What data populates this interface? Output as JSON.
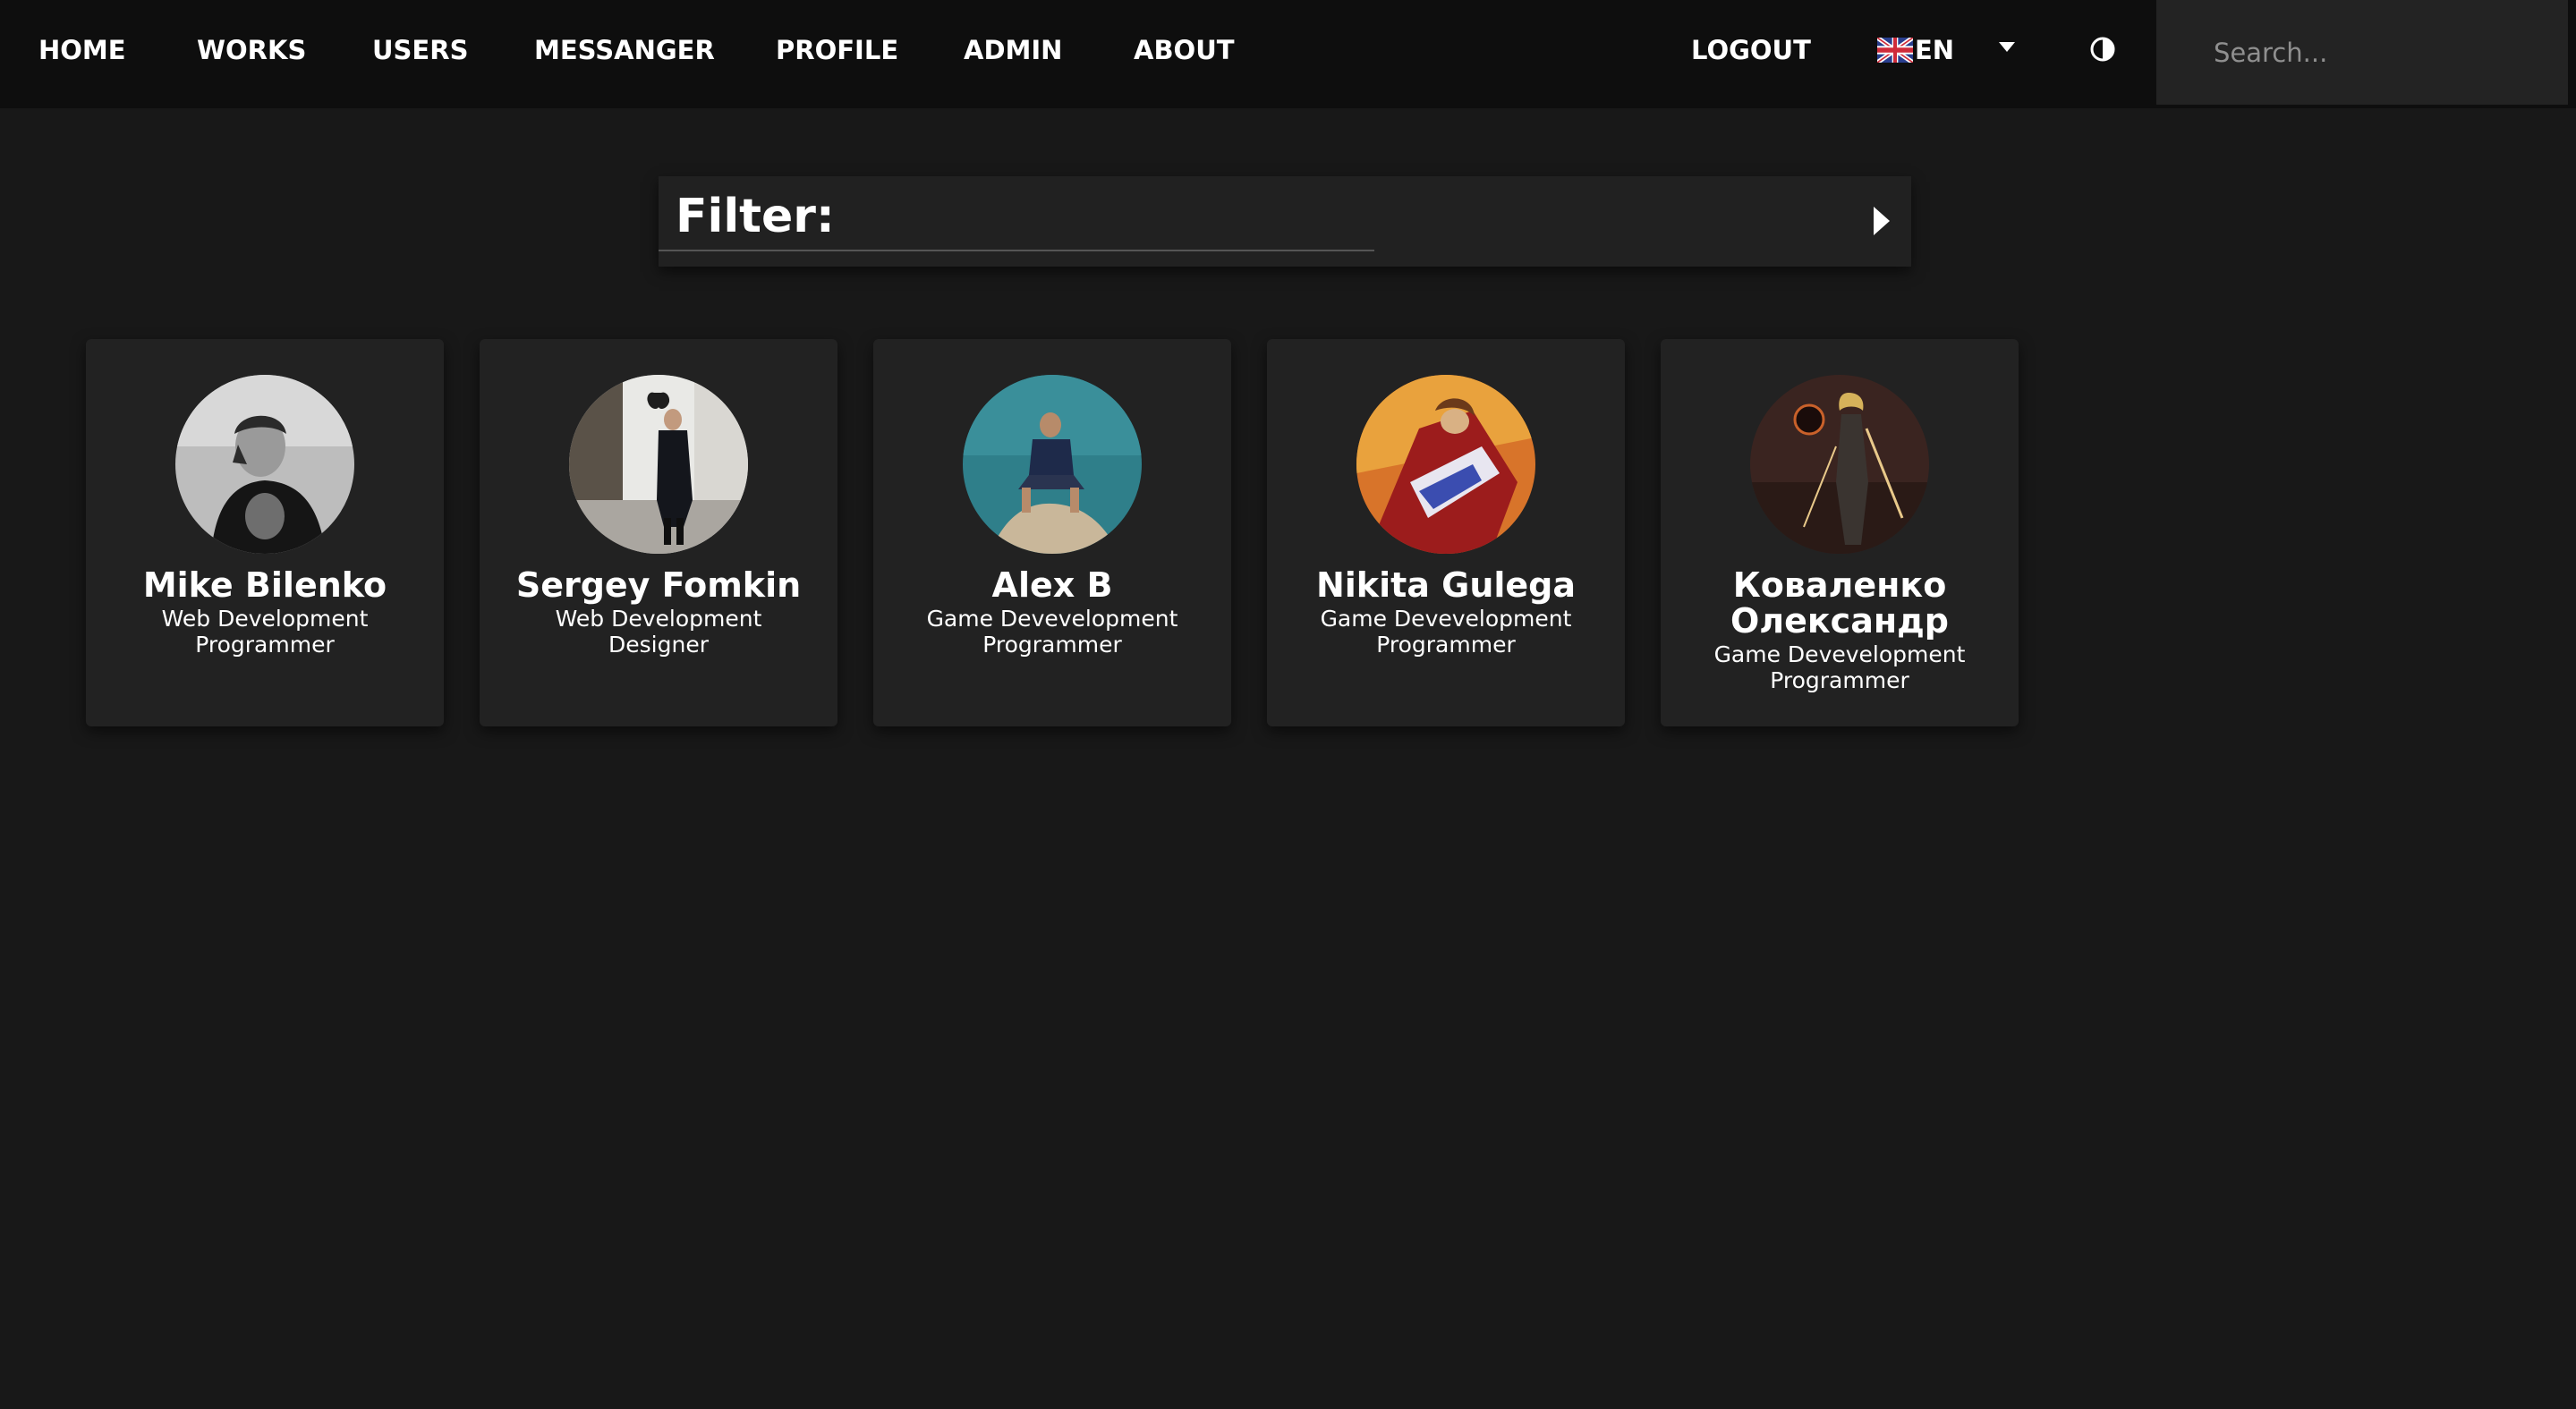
{
  "nav": {
    "links": [
      "HOME",
      "WORKS",
      "USERS",
      "MESSANGER",
      "PROFILE",
      "ADMIN",
      "ABOUT"
    ],
    "logout": "LOGOUT",
    "language": "EN",
    "search_placeholder": "Search..."
  },
  "filter": {
    "title": "Filter:"
  },
  "users": [
    {
      "name": "Mike Bilenko",
      "role_line1": "Web Development",
      "role_line2": "Programmer"
    },
    {
      "name": "Sergey Fomkin",
      "role_line1": "Web Development",
      "role_line2": "Designer"
    },
    {
      "name": "Alex B",
      "role_line1": "Game Devevelopment",
      "role_line2": "Programmer"
    },
    {
      "name": "Nikita Gulega",
      "role_line1": "Game Devevelopment",
      "role_line2": "Programmer"
    },
    {
      "name": "Коваленко Олександр",
      "role_line1": "Game Devevelopment",
      "role_line2": "Programmer"
    }
  ],
  "icons": {
    "flag": "uk-flag-icon",
    "language_caret": "chevron-down-icon",
    "theme": "contrast-icon",
    "filter_toggle": "caret-right-icon"
  }
}
